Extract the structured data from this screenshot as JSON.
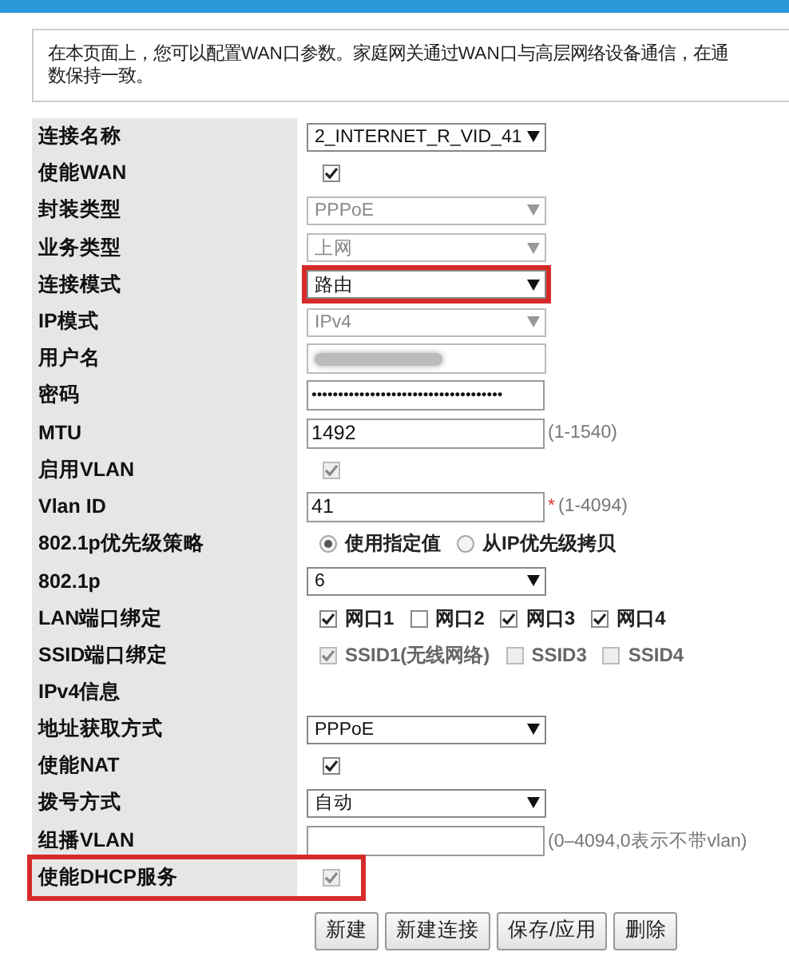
{
  "intro": {
    "lines": [
      "在本页面上，您可以配置WAN口参数。家庭网关通过WAN口与高层网络设备通信，在通",
      "数保持一致。"
    ]
  },
  "rows": [
    {
      "kind": "select",
      "label": "连接名称",
      "value": "2_INTERNET_R_VID_41",
      "disabled": false,
      "highlighted": false
    },
    {
      "kind": "checkbox",
      "label": "使能WAN",
      "checked": true,
      "disabled": false,
      "highlighted": false
    },
    {
      "kind": "select",
      "label": "封装类型",
      "value": "PPPoE",
      "disabled": true,
      "highlighted": false
    },
    {
      "kind": "select",
      "label": "业务类型",
      "value": "上网",
      "disabled": true,
      "highlighted": false
    },
    {
      "kind": "select",
      "label": "连接模式",
      "value": "路由",
      "disabled": false,
      "highlighted": true
    },
    {
      "kind": "select",
      "label": "IP模式",
      "value": "IPv4",
      "disabled": true,
      "highlighted": false
    },
    {
      "kind": "redacted",
      "label": "用户名",
      "highlighted": false
    },
    {
      "kind": "text",
      "label": "密码",
      "value": "••••••••••••••••••••••••••••••••••••",
      "secret": true,
      "highlighted": false
    },
    {
      "kind": "text",
      "label": "MTU",
      "value": "1492",
      "hint": "(1-1540)",
      "highlighted": false
    },
    {
      "kind": "checkbox",
      "label": "启用VLAN",
      "checked": true,
      "disabled": true,
      "highlighted": false
    },
    {
      "kind": "text",
      "label": "Vlan ID",
      "value": "41",
      "required_mark": "*",
      "hint": "(1-4094)",
      "highlighted": false
    },
    {
      "kind": "radio",
      "label": "802.1p优先级策略",
      "highlighted": false,
      "options": [
        {
          "label": "使用指定值",
          "selected": true
        },
        {
          "label": "从IP优先级拷贝",
          "selected": false
        }
      ]
    },
    {
      "kind": "select",
      "label": "802.1p",
      "value": "6",
      "disabled": false,
      "highlighted": false
    },
    {
      "kind": "checks",
      "label": "LAN端口绑定",
      "highlighted": false,
      "options": [
        {
          "label": "网口1",
          "checked": true,
          "disabled": false
        },
        {
          "label": "网口2",
          "checked": false,
          "disabled": false
        },
        {
          "label": "网口3",
          "checked": true,
          "disabled": false
        },
        {
          "label": "网口4",
          "checked": true,
          "disabled": false
        }
      ]
    },
    {
      "kind": "checks",
      "label": "SSID端口绑定",
      "highlighted": false,
      "options": [
        {
          "label": "SSID1(无线网络)",
          "checked": true,
          "disabled": true
        },
        {
          "label": "SSID3",
          "checked": false,
          "disabled": true
        },
        {
          "label": "SSID4",
          "checked": false,
          "disabled": true
        }
      ]
    },
    {
      "kind": "header",
      "label": "IPv4信息",
      "highlighted": false
    },
    {
      "kind": "select",
      "label": "地址获取方式",
      "value": "PPPoE",
      "disabled": false,
      "highlighted": false
    },
    {
      "kind": "checkbox",
      "label": "使能NAT",
      "checked": true,
      "disabled": false,
      "highlighted": false
    },
    {
      "kind": "select",
      "label": "拨号方式",
      "value": "自动",
      "disabled": false,
      "highlighted": false
    },
    {
      "kind": "text",
      "label": "组播VLAN",
      "value": "",
      "hint": "(0–4094,0表示不带vlan)",
      "highlighted": false
    },
    {
      "kind": "checkbox",
      "label": "使能DHCP服务",
      "checked": true,
      "disabled": true,
      "highlighted": true
    }
  ],
  "buttons": [
    "新建",
    "新建连接",
    "保存/应用",
    "删除"
  ]
}
